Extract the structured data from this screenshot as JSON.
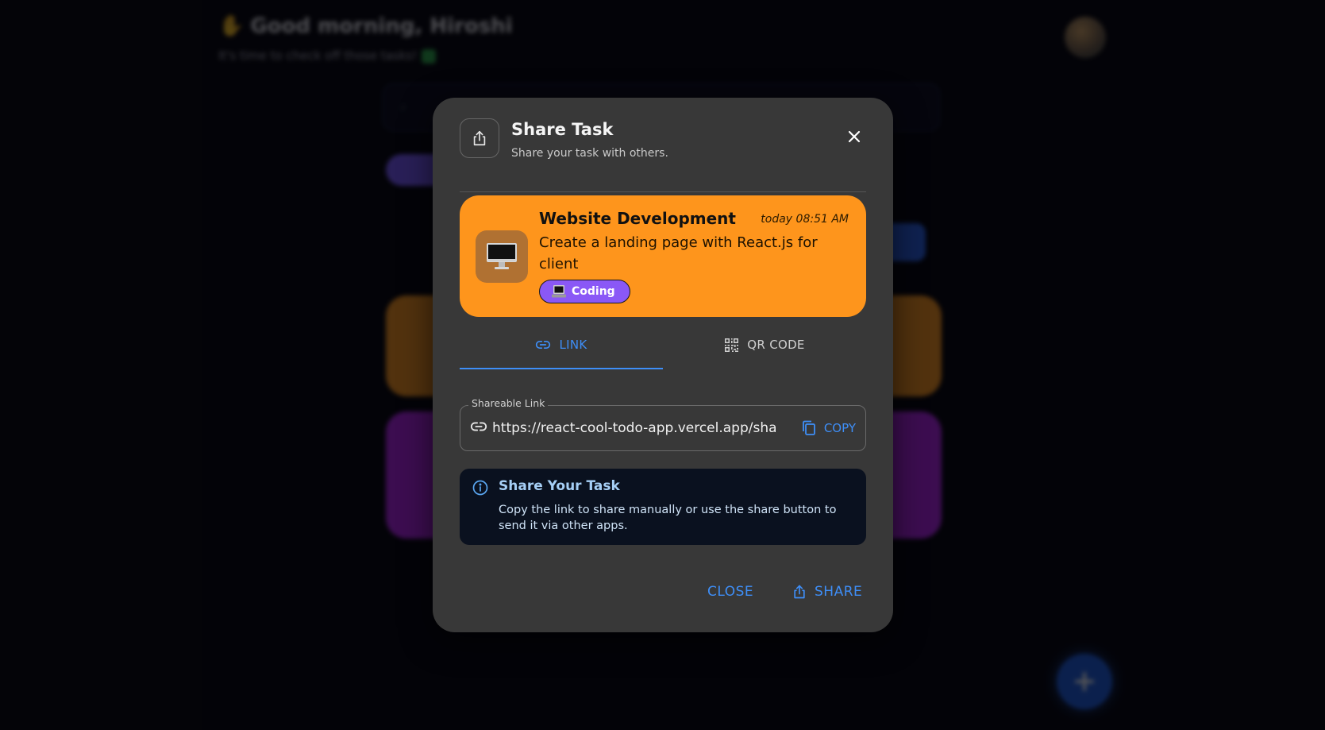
{
  "background": {
    "greeting": "Good morning, Hiroshi",
    "subtitle": "It's time to check off those tasks!"
  },
  "dialog": {
    "title": "Share Task",
    "subtitle": "Share your task with others.",
    "header_icon": "share-icon",
    "close_icon": "close-icon"
  },
  "task": {
    "name": "Website Development",
    "date": "today 08:51 AM",
    "description": "Create a landing page with React.js for client",
    "emoji": "desktop-computer",
    "color": "#fe951c",
    "category": {
      "label": "Coding",
      "color": "#8a58f6"
    }
  },
  "tabs": [
    {
      "label": "LINK",
      "icon": "link-icon",
      "active": true
    },
    {
      "label": "QR CODE",
      "icon": "qr-code-icon",
      "active": false
    }
  ],
  "link_field": {
    "label": "Shareable Link",
    "value": "https://react-cool-todo-app.vercel.app/sha",
    "copy_label": "COPY"
  },
  "info": {
    "title": "Share Your Task",
    "text": "Copy the link to share manually or use the share button to send it via other apps."
  },
  "actions": {
    "close_label": "CLOSE",
    "share_label": "SHARE"
  },
  "colors": {
    "accent": "#3e8ef7",
    "dialog_bg": "#383838",
    "info_bg": "#0a111f"
  }
}
